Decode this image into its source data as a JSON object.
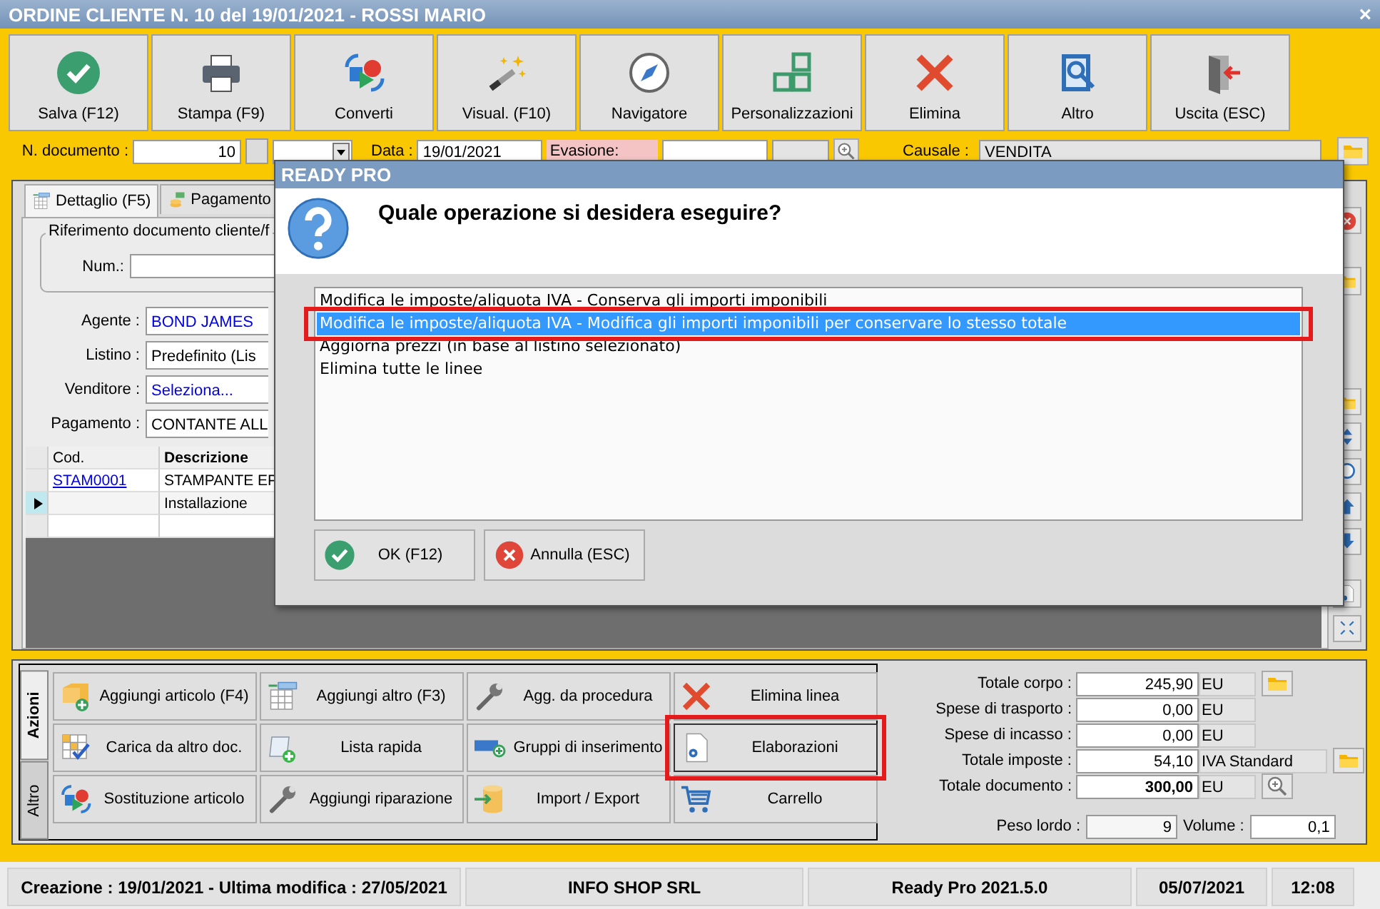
{
  "window": {
    "title": "ORDINE CLIENTE N. 10 del 19/01/2021 - ROSSI MARIO",
    "close": "×"
  },
  "toolbar": [
    "Salva (F12)",
    "Stampa (F9)",
    "Converti",
    "Visual. (F10)",
    "Navigatore",
    "Personalizzazioni",
    "Elimina",
    "Altro",
    "Uscita (ESC)"
  ],
  "header": {
    "doc_number_label": "N. documento :",
    "doc_number": "10",
    "date_label": "Data :",
    "date": "19/01/2021",
    "evasione_label": "Evasione:",
    "causale_label": "Causale :",
    "causale": "VENDITA"
  },
  "tabs": [
    {
      "label": "Dettaglio (F5)",
      "selected": true
    },
    {
      "label": "Pagamento",
      "selected": false
    }
  ],
  "reference_group": {
    "title": "Riferimento documento cliente/f",
    "num_label": "Num.:"
  },
  "fields": [
    {
      "label": "Agente :",
      "value": "BOND JAMES",
      "link": true
    },
    {
      "label": "Listino :",
      "value": "Predefinito (Lis",
      "link": false
    },
    {
      "label": "Venditore :",
      "value": "Seleziona...",
      "link": true
    },
    {
      "label": "Pagamento :",
      "value": "CONTANTE ALL",
      "link": false
    }
  ],
  "grid": {
    "columns": [
      "Cod.",
      "Descrizione"
    ],
    "rows": [
      {
        "cod": "STAM0001",
        "descrizione": "STAMPANTE EP",
        "current": false
      },
      {
        "descrizione": "Installazione",
        "current": true
      }
    ]
  },
  "action_tabs": [
    {
      "label": "Azioni",
      "selected": true
    },
    {
      "label": "Altro",
      "selected": false
    }
  ],
  "actions": [
    {
      "label": "Aggiungi articolo (F4)",
      "highlighted": false
    },
    {
      "label": "Aggiungi altro (F3)",
      "highlighted": false
    },
    {
      "label": "Agg. da procedura",
      "highlighted": false
    },
    {
      "label": "Elimina linea",
      "highlighted": false
    },
    {
      "label": "Carica da altro doc.",
      "highlighted": false
    },
    {
      "label": "Lista rapida",
      "highlighted": false
    },
    {
      "label": "Gruppi di inserimento",
      "highlighted": false
    },
    {
      "label": "Elaborazioni",
      "highlighted": true
    },
    {
      "label": "Sostituzione articolo",
      "highlighted": false
    },
    {
      "label": "Aggiungi riparazione",
      "highlighted": false
    },
    {
      "label": "Import / Export",
      "highlighted": false
    },
    {
      "label": "Carrello",
      "highlighted": false
    }
  ],
  "totals": [
    {
      "label": "Totale corpo :",
      "value": "245,90",
      "unit": "EU",
      "bold": false
    },
    {
      "label": "Spese di trasporto :",
      "value": "0,00",
      "unit": "EU",
      "bold": false
    },
    {
      "label": "Spese di incasso :",
      "value": "0,00",
      "unit": "EU",
      "bold": false
    },
    {
      "label": "Totale imposte :",
      "value": "54,10",
      "unit": "IVA Standard",
      "bold": false
    },
    {
      "label": "Totale documento :",
      "value": "300,00",
      "unit": "EU",
      "bold": true
    }
  ],
  "weight": {
    "label": "Peso lordo :",
    "value": "9"
  },
  "volume": {
    "label": "Volume :",
    "value": "0,1"
  },
  "status_bar": [
    "Creazione : 19/01/2021 - Ultima modifica : 27/05/2021",
    "INFO SHOP SRL",
    "Ready Pro 2021.5.0",
    "05/07/2021",
    "12:08"
  ],
  "dialog": {
    "title": "READY PRO",
    "question": "Quale operazione si desidera eseguire?",
    "options": [
      {
        "label": "Modifica le imposte/aliquota IVA - Conserva gli importi imponibili",
        "selected": false,
        "highlighted": false
      },
      {
        "label": "Modifica le imposte/aliquota IVA - Modifica gli importi imponibili per conservare lo stesso totale",
        "selected": true,
        "highlighted": true
      },
      {
        "label": "Aggiorna prezzi (in base al listino selezionato)",
        "selected": false,
        "highlighted": false
      },
      {
        "label": "Elimina tutte le linee",
        "selected": false,
        "highlighted": false
      }
    ],
    "buttons": [
      "OK (F12)",
      "Annulla (ESC)"
    ]
  }
}
